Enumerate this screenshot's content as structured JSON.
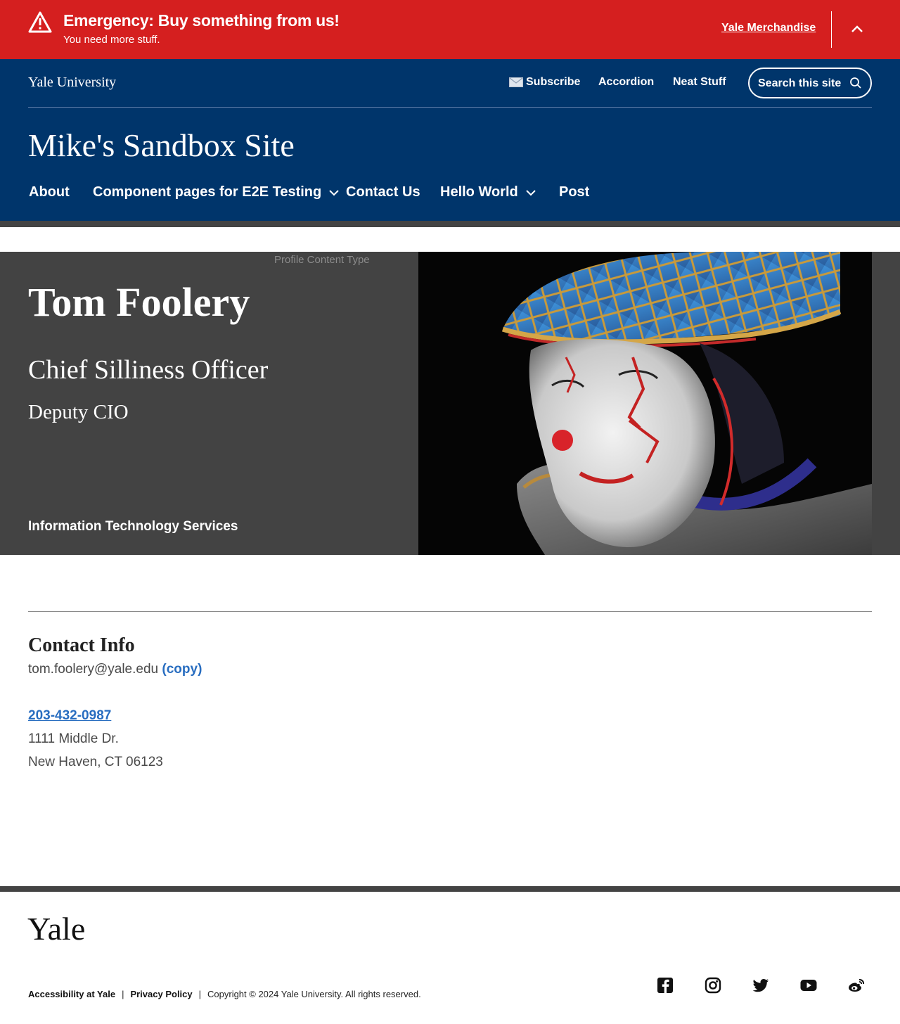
{
  "alert": {
    "title": "Emergency: Buy something from us!",
    "subtitle": "You need more stuff.",
    "link": "Yale Merchandise",
    "icon": "warning-triangle-icon",
    "color": "#d51f1f"
  },
  "header": {
    "wordmark": "Yale University",
    "utility": {
      "subscribe": "Subscribe",
      "accordion": "Accordion",
      "neat_stuff": "Neat Stuff"
    },
    "search": {
      "placeholder": "Search this site"
    },
    "site_title": "Mike's Sandbox Site",
    "nav": [
      "About",
      "Component pages for E2E Testing",
      "Contact Us",
      "Hello World",
      "Post"
    ],
    "color": "#00356b"
  },
  "profile": {
    "label": "Profile Content Type",
    "name": "Tom Foolery",
    "title": "Chief Silliness Officer",
    "subtitle": "Deputy CIO",
    "department": "Information Technology Services"
  },
  "contact": {
    "heading": "Contact Info",
    "email": "tom.foolery@yale.edu",
    "copy": "(copy)",
    "phone": "203-432-0987",
    "address_line1": "1111 Middle Dr.",
    "address_line2": "New Haven, CT 06123",
    "link_color": "#286dc0"
  },
  "footer": {
    "logo": "Yale",
    "accessibility": "Accessibility at Yale",
    "privacy": "Privacy Policy",
    "separator": "|",
    "copyright": "Copyright © 2024 Yale University. All rights reserved.",
    "social": [
      "facebook-icon",
      "instagram-icon",
      "twitter-icon",
      "youtube-icon",
      "weibo-icon"
    ]
  }
}
